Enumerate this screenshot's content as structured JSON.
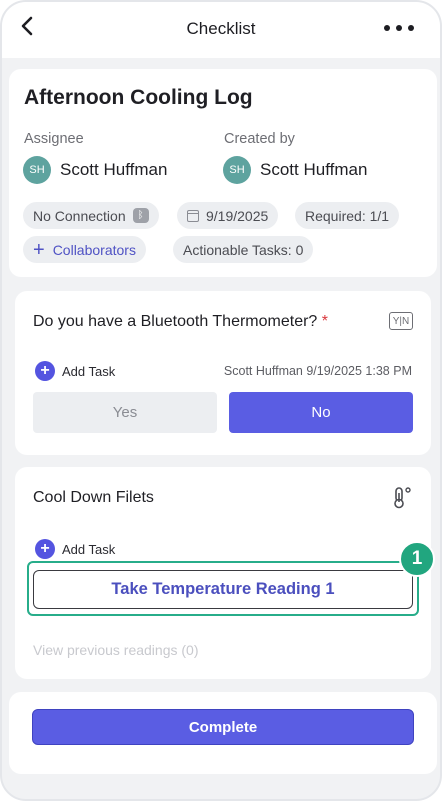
{
  "header": {
    "title": "Checklist",
    "back_icon": "chevron-left-icon",
    "more_icon": "ellipsis-horizontal-icon"
  },
  "log": {
    "title": "Afternoon Cooling Log",
    "assignee_label": "Assignee",
    "assignee_initials": "SH",
    "assignee_name": "Scott Huffman",
    "created_by_label": "Created by",
    "creator_initials": "SH",
    "creator_name": "Scott Huffman",
    "chips": {
      "connection": "No Connection",
      "date": "9/19/2025",
      "required": "Required: 1/1",
      "collaborators": "Collaborators",
      "actionable": "Actionable Tasks: 0"
    }
  },
  "question": {
    "text": "Do you have a Bluetooth Thermometer?",
    "required_mark": "*",
    "type_icon_text": "Y|N",
    "add_task_label": "Add Task",
    "meta": "Scott Huffman 9/19/2025 1:38 PM",
    "yes_label": "Yes",
    "no_label": "No",
    "selected": "No"
  },
  "task": {
    "name": "Cool Down Filets",
    "add_task_label": "Add Task",
    "reading_button": "Take Temperature Reading 1",
    "step_number": "1",
    "view_previous": "View previous readings (0)"
  },
  "footer": {
    "complete_label": "Complete"
  },
  "colors": {
    "accent": "#5a5de3",
    "highlight": "#27ad8a",
    "avatar": "#5ea39f",
    "required": "#d9373d"
  }
}
